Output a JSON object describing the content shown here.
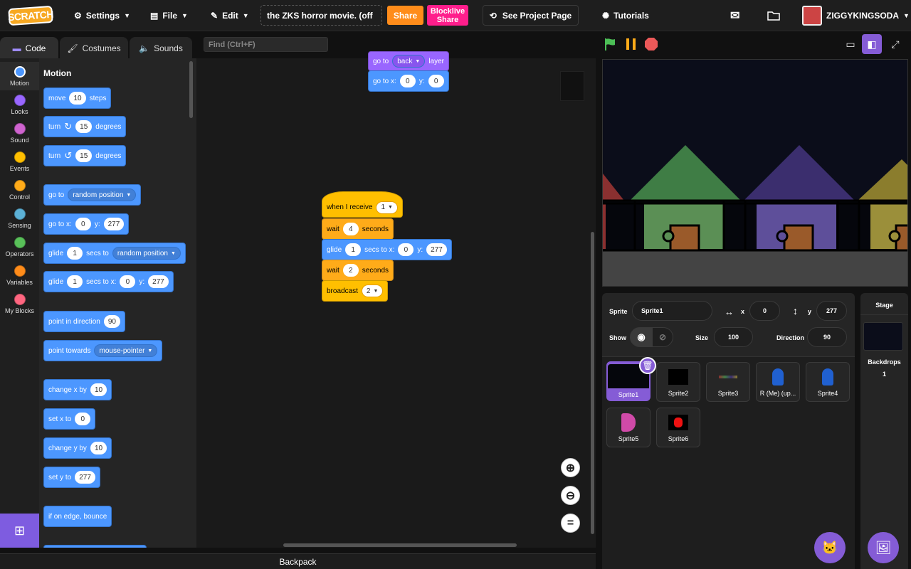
{
  "menu": {
    "logo": "SCRATCH",
    "settings": "Settings",
    "file": "File",
    "edit": "Edit",
    "project_title": "the ZKS horror movie. (off",
    "share": "Share",
    "blocklive_line1": "Blocklive",
    "blocklive_line2": "Share",
    "see_project_page": "See Project Page",
    "tutorials": "Tutorials",
    "username": "ZIGGYKINGSODA"
  },
  "tabs": {
    "code": "Code",
    "costumes": "Costumes",
    "sounds": "Sounds"
  },
  "find_placeholder": "Find (Ctrl+F)",
  "categories": [
    {
      "label": "Motion",
      "color": "#4c97ff"
    },
    {
      "label": "Looks",
      "color": "#9966ff"
    },
    {
      "label": "Sound",
      "color": "#cf63cf"
    },
    {
      "label": "Events",
      "color": "#ffbf00"
    },
    {
      "label": "Control",
      "color": "#ffab19"
    },
    {
      "label": "Sensing",
      "color": "#5cb1d6"
    },
    {
      "label": "Operators",
      "color": "#59c059"
    },
    {
      "label": "Variables",
      "color": "#ff8c1a"
    },
    {
      "label": "My Blocks",
      "color": "#ff6680"
    }
  ],
  "palette": {
    "heading": "Motion",
    "move": {
      "t1": "move",
      "v": "10",
      "t2": "steps"
    },
    "turn_cw": {
      "t1": "turn",
      "v": "15",
      "t2": "degrees"
    },
    "turn_ccw": {
      "t1": "turn",
      "v": "15",
      "t2": "degrees"
    },
    "goto": {
      "t1": "go to",
      "d": "random position"
    },
    "goto_xy": {
      "t1": "go to x:",
      "x": "0",
      "t2": "y:",
      "y": "277"
    },
    "glide_to": {
      "t1": "glide",
      "v": "1",
      "t2": "secs to",
      "d": "random position"
    },
    "glide_xy": {
      "t1": "glide",
      "v": "1",
      "t2": "secs to x:",
      "x": "0",
      "t3": "y:",
      "y": "277"
    },
    "point_dir": {
      "t1": "point in direction",
      "v": "90"
    },
    "point_towards": {
      "t1": "point towards",
      "d": "mouse-pointer"
    },
    "change_x": {
      "t1": "change x by",
      "v": "10"
    },
    "set_x": {
      "t1": "set x to",
      "v": "0"
    },
    "change_y": {
      "t1": "change y by",
      "v": "10"
    },
    "set_y": {
      "t1": "set y to",
      "v": "277"
    },
    "bounce": {
      "t1": "if on edge, bounce"
    }
  },
  "script_top": {
    "layer": {
      "t1": "go to",
      "d": "back",
      "t2": "layer"
    },
    "goto_xy": {
      "t1": "go to x:",
      "x": "0",
      "t2": "y:",
      "y": "0"
    }
  },
  "script_main": {
    "when_receive": {
      "t1": "when I receive",
      "d": "1"
    },
    "wait1": {
      "t1": "wait",
      "v": "4",
      "t2": "seconds"
    },
    "glide": {
      "t1": "glide",
      "v": "1",
      "t2": "secs to x:",
      "x": "0",
      "t3": "y:",
      "y": "277"
    },
    "wait2": {
      "t1": "wait",
      "v": "2",
      "t2": "seconds"
    },
    "broadcast": {
      "t1": "broadcast",
      "d": "2"
    }
  },
  "backpack": "Backpack",
  "sprite_info": {
    "sprite_label": "Sprite",
    "sprite_name": "Sprite1",
    "x_label": "x",
    "x": "0",
    "y_label": "y",
    "y": "277",
    "show_label": "Show",
    "size_label": "Size",
    "size": "100",
    "direction_label": "Direction",
    "direction": "90"
  },
  "sprites": [
    "Sprite1",
    "Sprite2",
    "Sprite3",
    "R (Me) (up...",
    "Sprite4",
    "Sprite5",
    "Sprite6"
  ],
  "stage_pane": {
    "title": "Stage",
    "backdrops_label": "Backdrops",
    "backdrops_count": "1"
  }
}
